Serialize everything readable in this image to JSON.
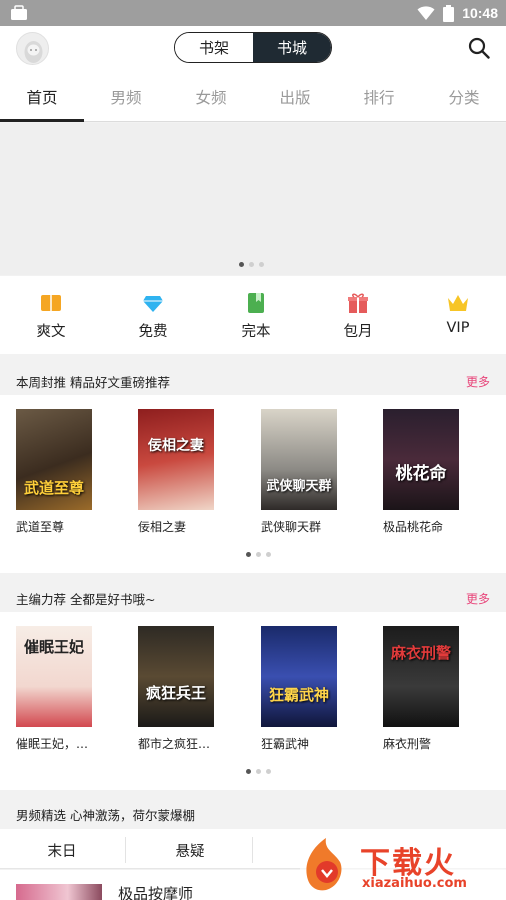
{
  "status_bar": {
    "time": "10:48"
  },
  "header": {
    "seg_left": "书架",
    "seg_right": "书城"
  },
  "tabs": [
    "首页",
    "男频",
    "女频",
    "出版",
    "排行",
    "分类"
  ],
  "quick": [
    {
      "label": "爽文",
      "icon": "book-icon"
    },
    {
      "label": "免费",
      "icon": "diamond-icon"
    },
    {
      "label": "完本",
      "icon": "bookmark-icon"
    },
    {
      "label": "包月",
      "icon": "gift-icon"
    },
    {
      "label": "VIP",
      "icon": "crown-icon"
    }
  ],
  "section1": {
    "title": "本周封推  精品好文重磅推荐",
    "more": "更多",
    "books": [
      {
        "name": "武道至尊",
        "cover_text": "武道至尊"
      },
      {
        "name": "佞相之妻",
        "cover_text": "佞相之妻"
      },
      {
        "name": "武侠聊天群",
        "cover_text": "武侠聊天群"
      },
      {
        "name": "极品桃花命",
        "cover_text": "桃花命"
      }
    ]
  },
  "section2": {
    "title": "主编力荐  全都是好书哦~",
    "more": "更多",
    "books": [
      {
        "name": "催眠王妃，…",
        "cover_text": "催眠王妃"
      },
      {
        "name": "都市之疯狂…",
        "cover_text": "疯狂兵王"
      },
      {
        "name": "狂霸武神",
        "cover_text": "狂霸武神"
      },
      {
        "name": "麻衣刑警",
        "cover_text": "麻衣刑警"
      }
    ]
  },
  "section3": {
    "title": "男频精选  心神激荡，荷尔蒙爆棚",
    "genres": [
      "末日",
      "悬疑"
    ],
    "first_item": "极品按摩师"
  },
  "watermark": {
    "text": "下载火",
    "sub": "xiazaihuo.com"
  },
  "colors": {
    "accent_pink": "#e8457a",
    "segment_dark": "#1f2a33"
  }
}
